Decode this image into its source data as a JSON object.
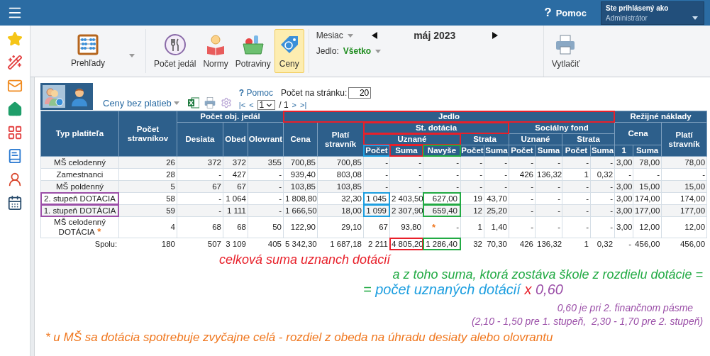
{
  "topbar": {
    "help_icon": "?",
    "help": "Pomoc",
    "user_label": "Ste prihlásený ako",
    "user": "Administrátor"
  },
  "toolbar": {
    "reports": "Prehľady",
    "tools": [
      {
        "kind": "dishes",
        "label": "Počet jedál",
        "selected": false
      },
      {
        "kind": "norms",
        "label": "Normy",
        "selected": false
      },
      {
        "kind": "groceries",
        "label": "Potraviny",
        "selected": false
      },
      {
        "kind": "prices",
        "label": "Ceny",
        "selected": true
      }
    ],
    "month_label": "Mesiac",
    "month": "máj 2023",
    "meal_label": "Jedlo:",
    "meal": "Všetko",
    "print": "Vytlačiť"
  },
  "panel": {
    "tiles": [
      {
        "kind": "payers",
        "selected": true
      },
      {
        "kind": "person",
        "selected": false
      }
    ],
    "view": "Ceny bez platieb",
    "help_icon": "?",
    "help": "Pomoc",
    "per_page_label": "Počet na stránku:",
    "per_page": "20",
    "pager": {
      "first": "|<",
      "prev": "<",
      "page": "1",
      "total": "/ 1",
      "next": ">",
      "last": ">|"
    }
  },
  "table": {
    "columns": [
      {
        "label": "Typ platiteľa"
      },
      {
        "label": "Počet stravníkov"
      },
      {
        "label": "Počet obj. jedál",
        "colspan": 3,
        "children": [
          {
            "label": "Desiata"
          },
          {
            "label": "Obed"
          },
          {
            "label": "Olovrant"
          }
        ]
      },
      {
        "label": "Jedlo",
        "colspan": 11,
        "color": "#e8202a",
        "children": [
          {
            "label": "Cena"
          },
          {
            "label": "Platí stravník"
          },
          {
            "label": "St. dotácia",
            "colspan": 5,
            "color": "#e8202a",
            "children": [
              {
                "label": "Uznané",
                "colspan": 3,
                "color": "#e8202a",
                "children": [
                  {
                    "label": "Počet",
                    "color": "#1e9fe0"
                  },
                  {
                    "label": "Suma",
                    "color": "#e8202a"
                  },
                  {
                    "label": "Navyše",
                    "color": "#22aa44"
                  }
                ]
              },
              {
                "label": "Strata",
                "colspan": 2,
                "children": [
                  {
                    "label": "Počet"
                  },
                  {
                    "label": "Suma"
                  }
                ]
              }
            ]
          },
          {
            "label": "Sociálny fond",
            "colspan": 4,
            "children": [
              {
                "label": "Uznané",
                "colspan": 2,
                "children": [
                  {
                    "label": "Počet"
                  },
                  {
                    "label": "Suma"
                  }
                ]
              },
              {
                "label": "Strata",
                "colspan": 2,
                "children": [
                  {
                    "label": "Počet"
                  },
                  {
                    "label": "Suma"
                  }
                ]
              }
            ]
          }
        ]
      },
      {
        "label": "Režijné náklady",
        "colspan": 3,
        "children": [
          {
            "label": "Cena",
            "colspan": 2,
            "rowspan": 2,
            "children": [
              {
                "label": "1"
              },
              {
                "label": "Suma"
              }
            ]
          },
          {
            "label": "Platí stravník"
          }
        ]
      }
    ],
    "rows": [
      {
        "kind": "item",
        "cells": [
          "MŠ celodenný",
          "26",
          "372",
          "372",
          "355",
          "700,85",
          "700,85",
          "-",
          "-",
          "-",
          "-",
          "-",
          "-",
          "-",
          "-",
          "-",
          "3,00",
          "78,00",
          "78,00"
        ]
      },
      {
        "kind": "item",
        "cells": [
          "Zamestnanci",
          "28",
          "-",
          "427",
          "-",
          "939,40",
          "803,08",
          "-",
          "-",
          "-",
          "-",
          "-",
          "426",
          "136,32",
          "1",
          "0,32",
          "-",
          "-",
          "-"
        ]
      },
      {
        "kind": "item",
        "cells": [
          "MŠ poldenný",
          "5",
          "67",
          "67",
          "-",
          "103,85",
          "103,85",
          "-",
          "-",
          "-",
          "-",
          "-",
          "-",
          "-",
          "-",
          "-",
          "3,00",
          "15,00",
          "15,00"
        ]
      },
      {
        "kind": "item",
        "cells": [
          {
            "text": "2. stupeň DOTACIA",
            "color": "#9b4fa8"
          },
          "58",
          "-",
          "1 064",
          "-",
          "1 808,80",
          "32,30",
          {
            "text": "1 045",
            "color": "#1e9fe0"
          },
          "2 403,50",
          {
            "text": "627,00",
            "color": "#22aa44"
          },
          "19",
          "43,70",
          "-",
          "-",
          "-",
          "-",
          "3,00",
          "174,00",
          "174,00"
        ]
      },
      {
        "kind": "item",
        "cells": [
          {
            "text": "1. stupeň DOTÁCIA",
            "color": "#9b4fa8"
          },
          "59",
          "-",
          "1 111",
          "-",
          "1 666,50",
          "18,00",
          {
            "text": "1 099",
            "color": "#1e9fe0"
          },
          "2 307,90",
          {
            "text": "659,40",
            "color": "#22aa44"
          },
          "12",
          "25,20",
          "-",
          "-",
          "-",
          "-",
          "3,00",
          "177,00",
          "177,00"
        ]
      },
      {
        "kind": "item",
        "cells": [
          {
            "text": "MŠ celodenný DOTÁCIA",
            "note": "*"
          },
          "4",
          "68",
          "68",
          "50",
          "122,90",
          "29,10",
          "67",
          "93,80",
          {
            "text": "-",
            "note": "*"
          },
          "1",
          "1,40",
          "-",
          "-",
          "-",
          "-",
          "3,00",
          "12,00",
          "12,00"
        ]
      },
      {
        "kind": "total",
        "cells": [
          "Spolu:",
          "180",
          "507",
          "3 109",
          "405",
          "5 342,30",
          "1 687,18",
          "2 211",
          {
            "text": "4 805,20",
            "color": "#e8202a"
          },
          {
            "text": "1 286,40",
            "color": "#22aa44"
          },
          "32",
          "70,30",
          "426",
          "136,32",
          "1",
          "0,32",
          "-",
          "456,00",
          "456,00"
        ]
      }
    ]
  },
  "notes": [
    {
      "kind": "caption",
      "parts": [
        {
          "text": "celková suma uznanch dotácií",
          "color": "#e8202a"
        }
      ]
    },
    {
      "kind": "lead",
      "parts": [
        {
          "text": "a z toho suma, ktorá zostáva škole z rozdielu dotácie =",
          "color": "#22aa44"
        }
      ]
    },
    {
      "kind": "equation",
      "parts": [
        {
          "text": "= ",
          "color": "#22aa44"
        },
        {
          "text": "počet uznaných dotácií",
          "color": "#1e9fe0"
        },
        {
          "text": " x ",
          "color": "#e8202a"
        },
        {
          "text": "0,60",
          "color": "#9b4fa8"
        }
      ]
    },
    {
      "kind": "remark",
      "parts": [
        {
          "text": "0,60 je pri 2. finančnom pásme",
          "color": "#9b4fa8"
        }
      ]
    },
    {
      "kind": "remark",
      "parts": [
        {
          "text": "(2,10 - 1,50 pre 1. stupeň,  2,30 - 1,70 pre 2. stupeň)",
          "color": "#9b4fa8"
        }
      ]
    },
    {
      "kind": "footnote",
      "parts": [
        {
          "text": "* u MŠ sa dotácia spotrebuje zvyčajne celá - rozdiel z obeda na úhradu desiaty alebo olovrantu",
          "color": "#f07820"
        }
      ]
    }
  ]
}
